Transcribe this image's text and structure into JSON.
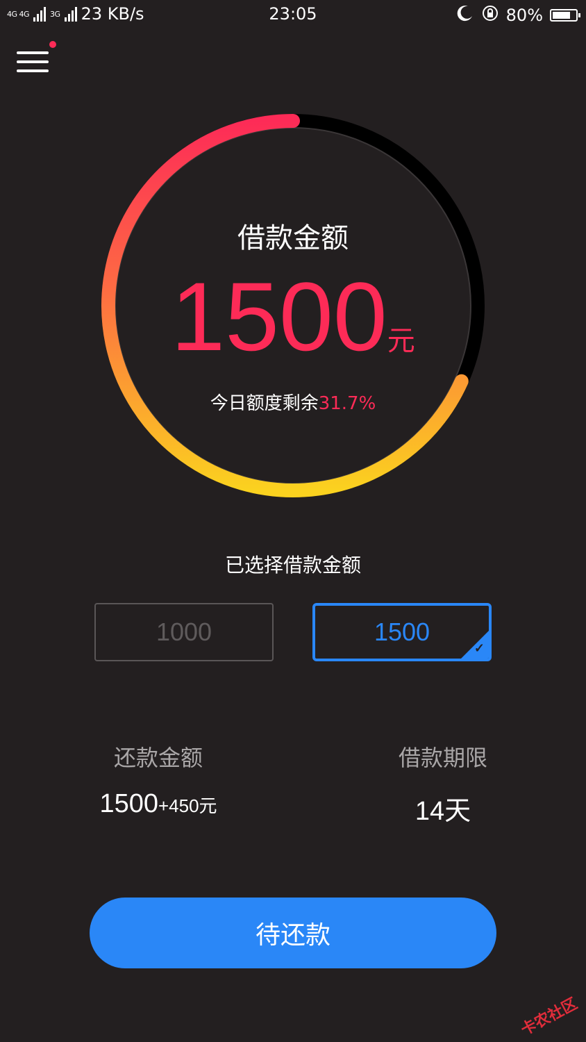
{
  "status_bar": {
    "signal_1": "4G 4G",
    "signal_2": "3G",
    "speed": "23 KB/s",
    "time": "23:05",
    "battery": "80%",
    "battery_level": 0.8,
    "icons": [
      "moon-icon",
      "rotation-lock-icon"
    ]
  },
  "header": {
    "menu_icon": "hamburger-menu-icon",
    "notification_dot_color": "#fd2b57"
  },
  "gauge": {
    "title": "借款金额",
    "amount": "1500",
    "unit": "元",
    "remain_label": "今日额度剩余",
    "remain_value": "31.7%",
    "progress_fraction": 0.683,
    "gradient_colors": [
      "#fd2b57",
      "#fd6b43",
      "#fbd21f"
    ],
    "track_color": "#000000"
  },
  "selection": {
    "label": "已选择借款金额",
    "options": [
      {
        "value": "1000",
        "selected": false
      },
      {
        "value": "1500",
        "selected": true
      }
    ]
  },
  "info": {
    "repay_label": "还款金额",
    "repay_value": "1500",
    "repay_extra": "+450元",
    "term_label": "借款期限",
    "term_value": "14天"
  },
  "action": {
    "button_label": "待还款",
    "button_color": "#2a87f7"
  },
  "watermark": "卡农社区"
}
